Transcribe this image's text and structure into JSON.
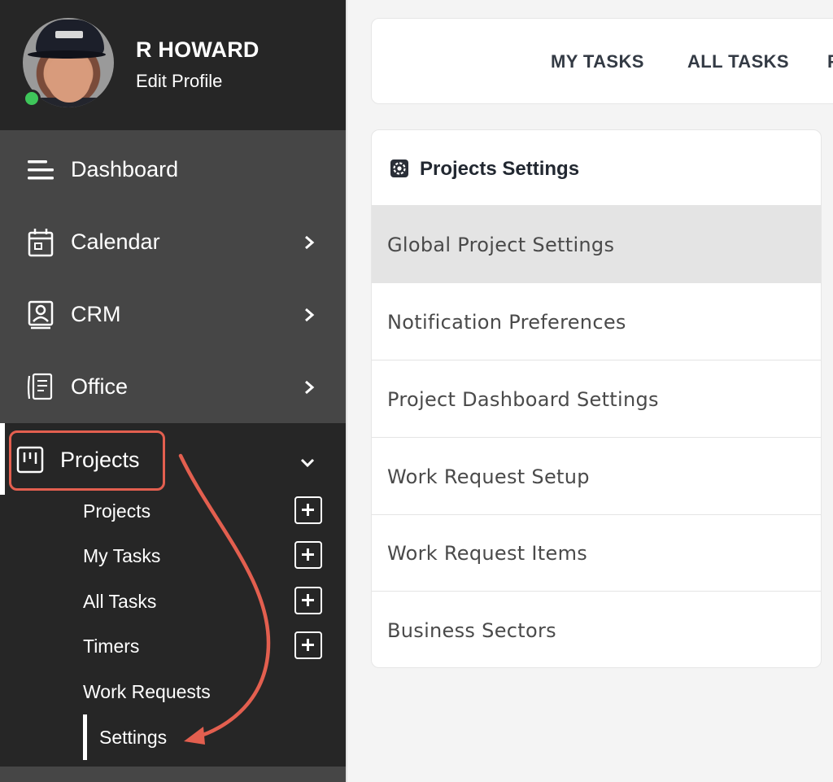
{
  "profile": {
    "name": "R HOWARD",
    "edit_label": "Edit Profile",
    "status": "online",
    "status_color": "#3ec65a"
  },
  "sidebar": {
    "items": [
      {
        "label": "Dashboard",
        "icon": "menu-lines-icon",
        "expandable": false
      },
      {
        "label": "Calendar",
        "icon": "calendar-icon",
        "expandable": true
      },
      {
        "label": "CRM",
        "icon": "contact-card-icon",
        "expandable": true
      },
      {
        "label": "Office",
        "icon": "office-document-icon",
        "expandable": true
      }
    ],
    "active_item": {
      "label": "Projects",
      "icon": "kanban-board-icon",
      "expanded": true
    },
    "sub_items": [
      {
        "label": "Projects",
        "has_add": true
      },
      {
        "label": "My Tasks",
        "has_add": true
      },
      {
        "label": "All Tasks",
        "has_add": true
      },
      {
        "label": "Timers",
        "has_add": true
      },
      {
        "label": "Work Requests",
        "has_add": false
      },
      {
        "label": "Settings",
        "has_add": false,
        "active": true
      }
    ]
  },
  "top_tabs": [
    "MY TASKS",
    "ALL TASKS",
    "P"
  ],
  "settings_card": {
    "title": "Projects Settings",
    "icon": "gear-icon",
    "rows": [
      {
        "label": "Global Project Settings",
        "selected": true
      },
      {
        "label": "Notification Preferences",
        "selected": false
      },
      {
        "label": "Project Dashboard Settings",
        "selected": false
      },
      {
        "label": "Work Request Setup",
        "selected": false
      },
      {
        "label": "Work Request Items",
        "selected": false
      },
      {
        "label": "Business Sectors",
        "selected": false
      }
    ]
  },
  "colors": {
    "sidebar_bg": "#262626",
    "sidebar_section_bg": "#464646",
    "annotation": "#e35f4f",
    "selected_row": "#e4e4e4"
  }
}
